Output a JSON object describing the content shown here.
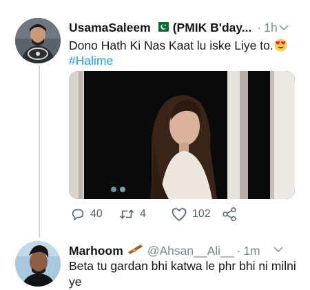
{
  "tweet": {
    "author": "UsamaSaleem",
    "author_suffix": "(PMIK B'day...",
    "time": "1h",
    "text": "Dono Hath Ki Nas Kaat lu iske Liye to.",
    "emoji": "heart-eyes-emoji",
    "hashtag": "#Halime",
    "stats": {
      "replies": "40",
      "retweets": "4",
      "likes": "102"
    }
  },
  "reply": {
    "author": "Marhoom",
    "handle": "@Ahsan__Ali__",
    "time": "1m",
    "text": "Beta tu gardan bhi katwa le phr bhi ni milni ye"
  },
  "icons": {
    "flag": "pakistan-flag-icon",
    "reply": "reply-icon",
    "retweet": "retweet-icon",
    "like": "heart-icon",
    "share": "share-icon",
    "more": "chevron-down-icon",
    "reply_emoji": "cigar-emoji-icon"
  },
  "colors": {
    "link": "#1d9bf0",
    "muted": "#7a8791",
    "text": "#14171a",
    "thread": "#cfd9de"
  }
}
